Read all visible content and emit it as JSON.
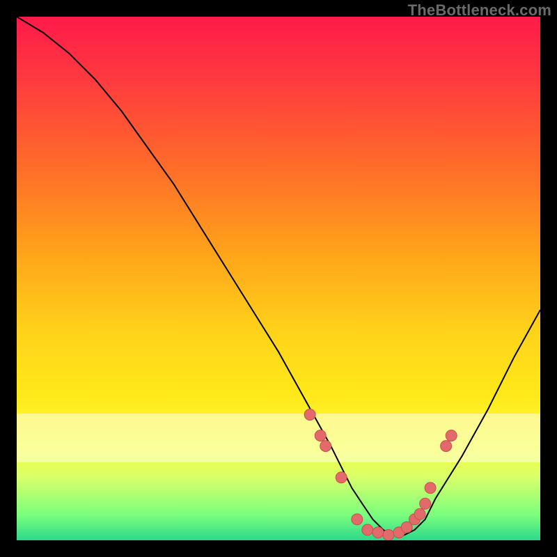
{
  "watermark": "TheBottleneck.com",
  "colors": {
    "dot_fill": "#e26a6a",
    "dot_stroke": "#c94f4f",
    "curve": "#000000"
  },
  "chart_data": {
    "type": "line",
    "title": "",
    "xlabel": "",
    "ylabel": "",
    "xlim": [
      0,
      100
    ],
    "ylim": [
      0,
      100
    ],
    "grid": false,
    "series": [
      {
        "name": "curve",
        "x": [
          0,
          5,
          10,
          15,
          20,
          25,
          30,
          35,
          40,
          45,
          50,
          55,
          60,
          62,
          64,
          66,
          68,
          70,
          72,
          74,
          76,
          78,
          80,
          85,
          90,
          95,
          100
        ],
        "values": [
          100,
          97,
          93,
          88,
          82,
          75,
          68,
          60,
          52,
          44,
          36,
          27,
          18,
          14,
          10,
          7,
          4,
          2,
          1,
          1,
          2,
          4,
          8,
          16,
          25,
          35,
          44
        ]
      }
    ],
    "highlight_points": [
      {
        "x": 56,
        "y": 24
      },
      {
        "x": 58,
        "y": 20
      },
      {
        "x": 59,
        "y": 18
      },
      {
        "x": 62,
        "y": 12
      },
      {
        "x": 65,
        "y": 4
      },
      {
        "x": 67,
        "y": 2
      },
      {
        "x": 69,
        "y": 1.5
      },
      {
        "x": 71,
        "y": 1
      },
      {
        "x": 73,
        "y": 1.5
      },
      {
        "x": 74.5,
        "y": 2.5
      },
      {
        "x": 76,
        "y": 4
      },
      {
        "x": 77,
        "y": 5
      },
      {
        "x": 78,
        "y": 7
      },
      {
        "x": 79,
        "y": 10
      },
      {
        "x": 82,
        "y": 18
      },
      {
        "x": 83,
        "y": 20
      }
    ]
  }
}
